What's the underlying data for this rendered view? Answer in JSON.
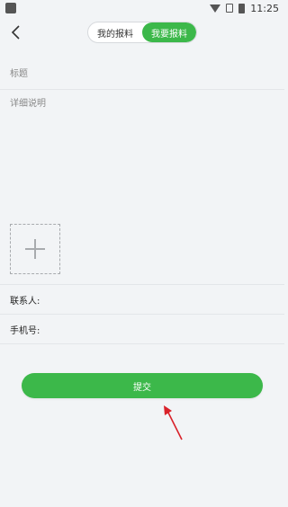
{
  "status_bar": {
    "time": "11:25"
  },
  "header": {
    "tabs": [
      {
        "label": "我的报料",
        "active": false
      },
      {
        "label": "我要报料",
        "active": true
      }
    ]
  },
  "form": {
    "title_placeholder": "标题",
    "detail_placeholder": "详细说明",
    "contact_label": "联系人:",
    "phone_label": "手机号:",
    "contact_value": "",
    "phone_value": ""
  },
  "submit_label": "提交",
  "colors": {
    "accent": "#3cb84a",
    "background": "#f2f4f6",
    "annotation_arrow": "#d9222a"
  }
}
